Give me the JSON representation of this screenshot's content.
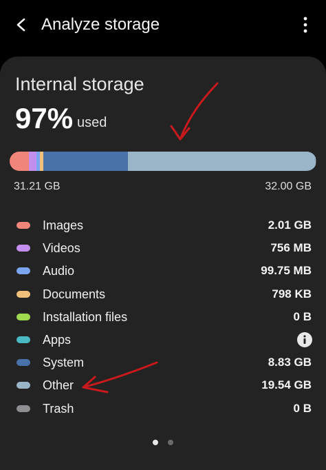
{
  "header": {
    "title": "Analyze storage",
    "back_icon": "chevron-left-icon",
    "more_icon": "more-vertical-icon"
  },
  "storage": {
    "name": "Internal storage",
    "percent_used": "97%",
    "used_suffix": "used",
    "used_amount": "31.21 GB",
    "total_amount": "32.00 GB"
  },
  "categories": [
    {
      "label": "Images",
      "value": "2.01 GB",
      "color": "#f0857a",
      "gb": 2.01
    },
    {
      "label": "Videos",
      "value": "756 MB",
      "color": "#c28ff0",
      "gb": 0.756
    },
    {
      "label": "Audio",
      "value": "99.75 MB",
      "color": "#7aa5f0",
      "gb": 0.09975
    },
    {
      "label": "Documents",
      "value": "798 KB",
      "color": "#f3c07c",
      "gb": 0.000798
    },
    {
      "label": "Installation files",
      "value": "0 B",
      "color": "#9fd94f",
      "gb": 0
    },
    {
      "label": "Apps",
      "value": "",
      "color": "#49b9c4",
      "gb": 0,
      "icon": "info-icon"
    },
    {
      "label": "System",
      "value": "8.83 GB",
      "color": "#4a72aa",
      "gb": 8.83
    },
    {
      "label": "Other",
      "value": "19.54 GB",
      "color": "#9bb5c8",
      "gb": 19.54
    },
    {
      "label": "Trash",
      "value": "0 B",
      "color": "#8e8e93",
      "gb": 0
    }
  ],
  "bar_free_color": "#5b5b5b",
  "pager": {
    "pages": 2,
    "active": 1
  },
  "accent_annotation_color": "#c8191c"
}
